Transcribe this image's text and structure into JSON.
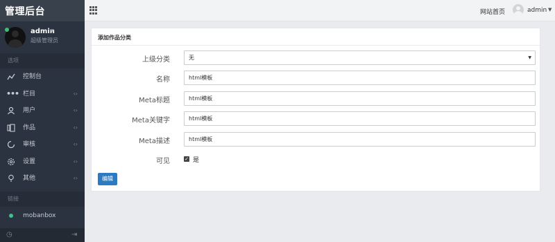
{
  "brand": "管理后台",
  "user": {
    "name": "admin",
    "role": "超级管理员"
  },
  "sidebar": {
    "section_label": "选项",
    "items": [
      {
        "label": "控制台",
        "icon": "chart-icon",
        "has_arrow": false
      },
      {
        "label": "栏目",
        "icon": "dots-icon",
        "has_arrow": true
      },
      {
        "label": "用户",
        "icon": "user-icon",
        "has_arrow": true
      },
      {
        "label": "作品",
        "icon": "book-icon",
        "has_arrow": true
      },
      {
        "label": "审核",
        "icon": "spinner-icon",
        "has_arrow": true
      },
      {
        "label": "设置",
        "icon": "gear-icon",
        "has_arrow": true
      },
      {
        "label": "其他",
        "icon": "lightbulb-icon",
        "has_arrow": true
      }
    ],
    "links_label": "链接",
    "links": [
      {
        "label": "mobanbox"
      }
    ]
  },
  "topbar": {
    "home_link": "网站首页",
    "user_name": "admin"
  },
  "form": {
    "title": "添加作品分类",
    "parent": {
      "label": "上级分类",
      "value": "无"
    },
    "name": {
      "label": "名称",
      "value": "html模板"
    },
    "meta_title": {
      "label": "Meta标题",
      "value": "html模板"
    },
    "meta_keywords": {
      "label": "Meta关键字",
      "value": "html模板"
    },
    "meta_description": {
      "label": "Meta描述",
      "value": "html模板"
    },
    "visible": {
      "label": "可见",
      "option": "是",
      "checked": true
    },
    "submit": "编辑"
  },
  "colors": {
    "sidebar_bg": "#2b3340",
    "brand_bg": "#39414c",
    "accent": "#2c7bc2",
    "online": "#3fbf73"
  }
}
